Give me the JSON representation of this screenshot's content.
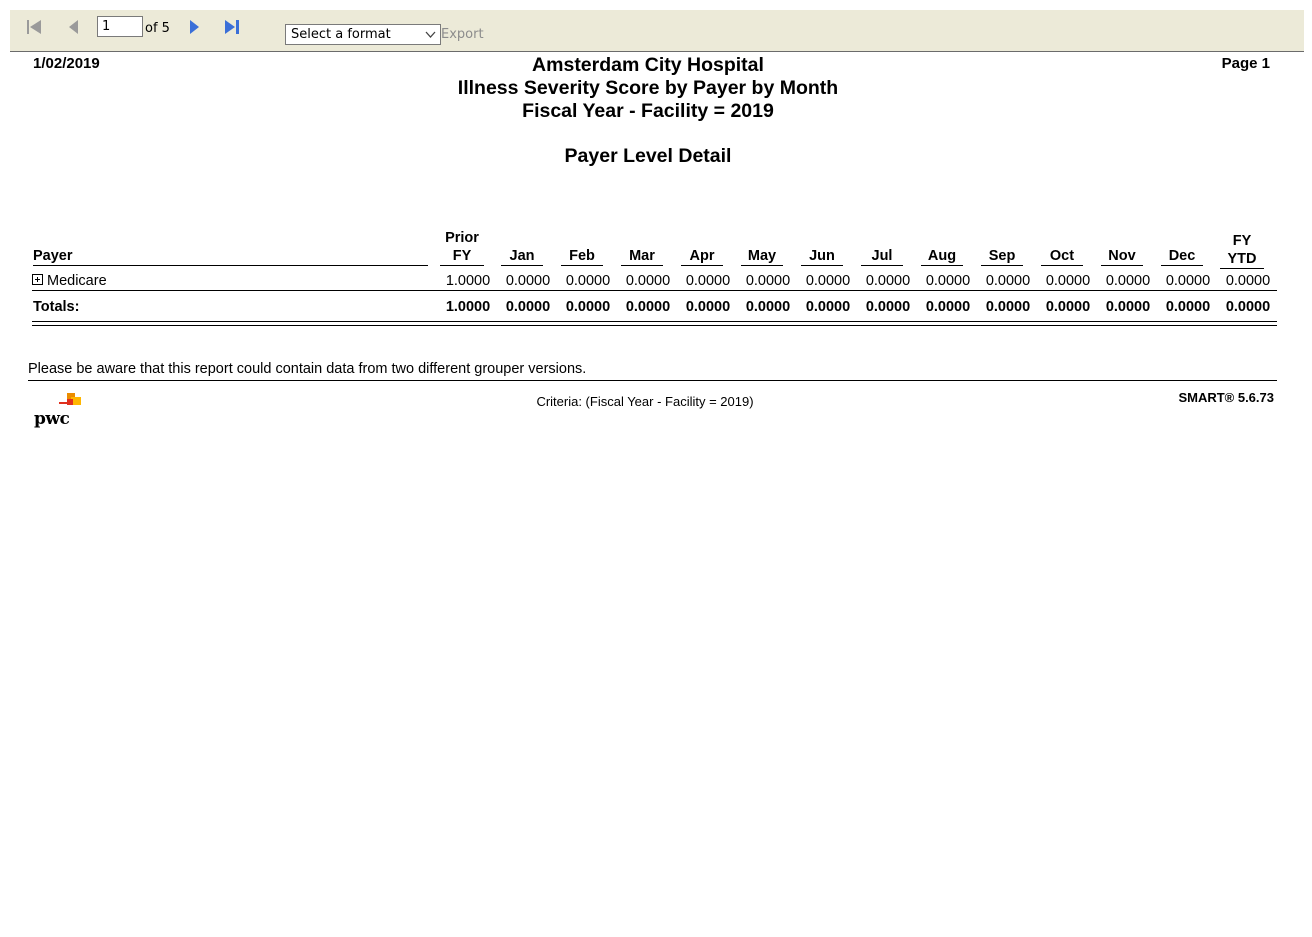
{
  "toolbar": {
    "page_input_value": "1",
    "of_pages": "of 5",
    "format_select_value": "Select a format",
    "export_label": "Export"
  },
  "report": {
    "date": "1/02/2019",
    "page_label": "Page 1",
    "title_line1": "Amsterdam City Hospital",
    "title_line2": "Illness Severity Score by Payer by Month",
    "title_line3": "Fiscal Year - Facility = 2019",
    "subtitle": "Payer Level Detail"
  },
  "table": {
    "payer_header": "Payer",
    "columns": [
      {
        "line1": "Prior",
        "line2": "FY"
      },
      {
        "line1": "",
        "line2": "Jan"
      },
      {
        "line1": "",
        "line2": "Feb"
      },
      {
        "line1": "",
        "line2": "Mar"
      },
      {
        "line1": "",
        "line2": "Apr"
      },
      {
        "line1": "",
        "line2": "May"
      },
      {
        "line1": "",
        "line2": "Jun"
      },
      {
        "line1": "",
        "line2": "Jul"
      },
      {
        "line1": "",
        "line2": "Aug"
      },
      {
        "line1": "",
        "line2": "Sep"
      },
      {
        "line1": "",
        "line2": "Oct"
      },
      {
        "line1": "",
        "line2": "Nov"
      },
      {
        "line1": "",
        "line2": "Dec"
      },
      {
        "line1": "FY",
        "line2": "YTD"
      }
    ],
    "rows": [
      {
        "payer": "Medicare",
        "values": [
          "1.0000",
          "0.0000",
          "0.0000",
          "0.0000",
          "0.0000",
          "0.0000",
          "0.0000",
          "0.0000",
          "0.0000",
          "0.0000",
          "0.0000",
          "0.0000",
          "0.0000",
          "0.0000"
        ]
      }
    ],
    "totals_label": "Totals:",
    "totals": [
      "1.0000",
      "0.0000",
      "0.0000",
      "0.0000",
      "0.0000",
      "0.0000",
      "0.0000",
      "0.0000",
      "0.0000",
      "0.0000",
      "0.0000",
      "0.0000",
      "0.0000",
      "0.0000"
    ]
  },
  "footer": {
    "notice": "Please be aware that this report could contain data from two different grouper versions.",
    "criteria": "Criteria: (Fiscal Year - Facility = 2019)",
    "version": "SMART® 5.6.73",
    "logo_text": "pwc"
  },
  "colors": {
    "toolbar_bg": "#ecead8",
    "nav_active": "#3a6fd8",
    "nav_disabled": "#9a9a9a",
    "logo_orange": "#e0301e",
    "logo_yellow": "#ffb600"
  }
}
